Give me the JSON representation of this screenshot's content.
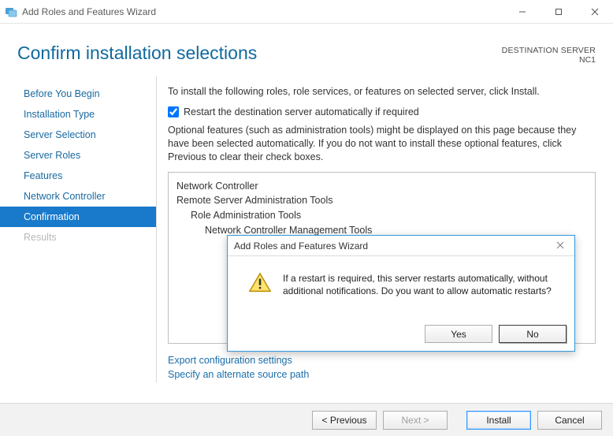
{
  "titlebar": {
    "title": "Add Roles and Features Wizard"
  },
  "page": {
    "title": "Confirm installation selections"
  },
  "destination": {
    "label": "DESTINATION SERVER",
    "name": "NC1"
  },
  "nav": {
    "items": [
      {
        "label": "Before You Begin"
      },
      {
        "label": "Installation Type"
      },
      {
        "label": "Server Selection"
      },
      {
        "label": "Server Roles"
      },
      {
        "label": "Features"
      },
      {
        "label": "Network Controller"
      },
      {
        "label": "Confirmation"
      },
      {
        "label": "Results"
      }
    ]
  },
  "main": {
    "intro": "To install the following roles, role services, or features on selected server, click Install.",
    "checkbox_label": "Restart the destination server automatically if required",
    "optional_note": "Optional features (such as administration tools) might be displayed on this page because they have been selected automatically. If you do not want to install these optional features, click Previous to clear their check boxes.",
    "features": {
      "l0a": "Network Controller",
      "l0b": "Remote Server Administration Tools",
      "l1": "Role Administration Tools",
      "l2": "Network Controller Management Tools"
    },
    "links": {
      "export": "Export configuration settings",
      "alt_path": "Specify an alternate source path"
    }
  },
  "footer": {
    "previous": "< Previous",
    "next": "Next >",
    "install": "Install",
    "cancel": "Cancel"
  },
  "modal": {
    "title": "Add Roles and Features Wizard",
    "message": "If a restart is required, this server restarts automatically, without additional notifications. Do you want to allow automatic restarts?",
    "yes": "Yes",
    "no": "No"
  }
}
